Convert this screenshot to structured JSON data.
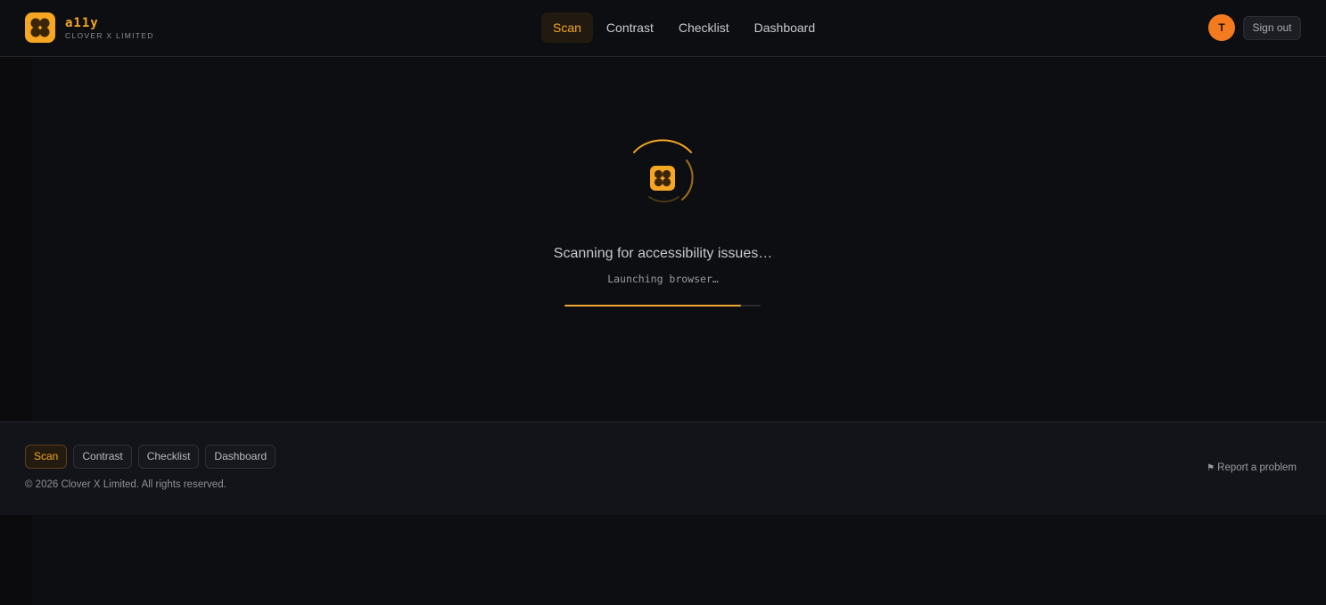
{
  "brand": {
    "name": "a11y",
    "subtitle": "CLOVER X LIMITED",
    "accent_color": "#f5a623",
    "icon": "clover-logo-icon"
  },
  "header": {
    "nav": [
      {
        "label": "Scan",
        "active": true
      },
      {
        "label": "Contrast",
        "active": false
      },
      {
        "label": "Checklist",
        "active": false
      },
      {
        "label": "Dashboard",
        "active": false
      }
    ],
    "avatar_initial": "T",
    "avatar_color": "#f47a1f",
    "signout_label": "Sign out"
  },
  "scan": {
    "title": "Scanning for accessibility issues…",
    "status": "Launching browser…",
    "progress_fraction": 0.9,
    "progress_color": "#f2a531"
  },
  "footer": {
    "nav": [
      {
        "label": "Scan",
        "active": true
      },
      {
        "label": "Contrast",
        "active": false
      },
      {
        "label": "Checklist",
        "active": false
      },
      {
        "label": "Dashboard",
        "active": false
      }
    ],
    "copyright": "© 2026 Clover X Limited. All rights reserved.",
    "report_label": "Report a problem",
    "report_icon": "flag-icon"
  }
}
